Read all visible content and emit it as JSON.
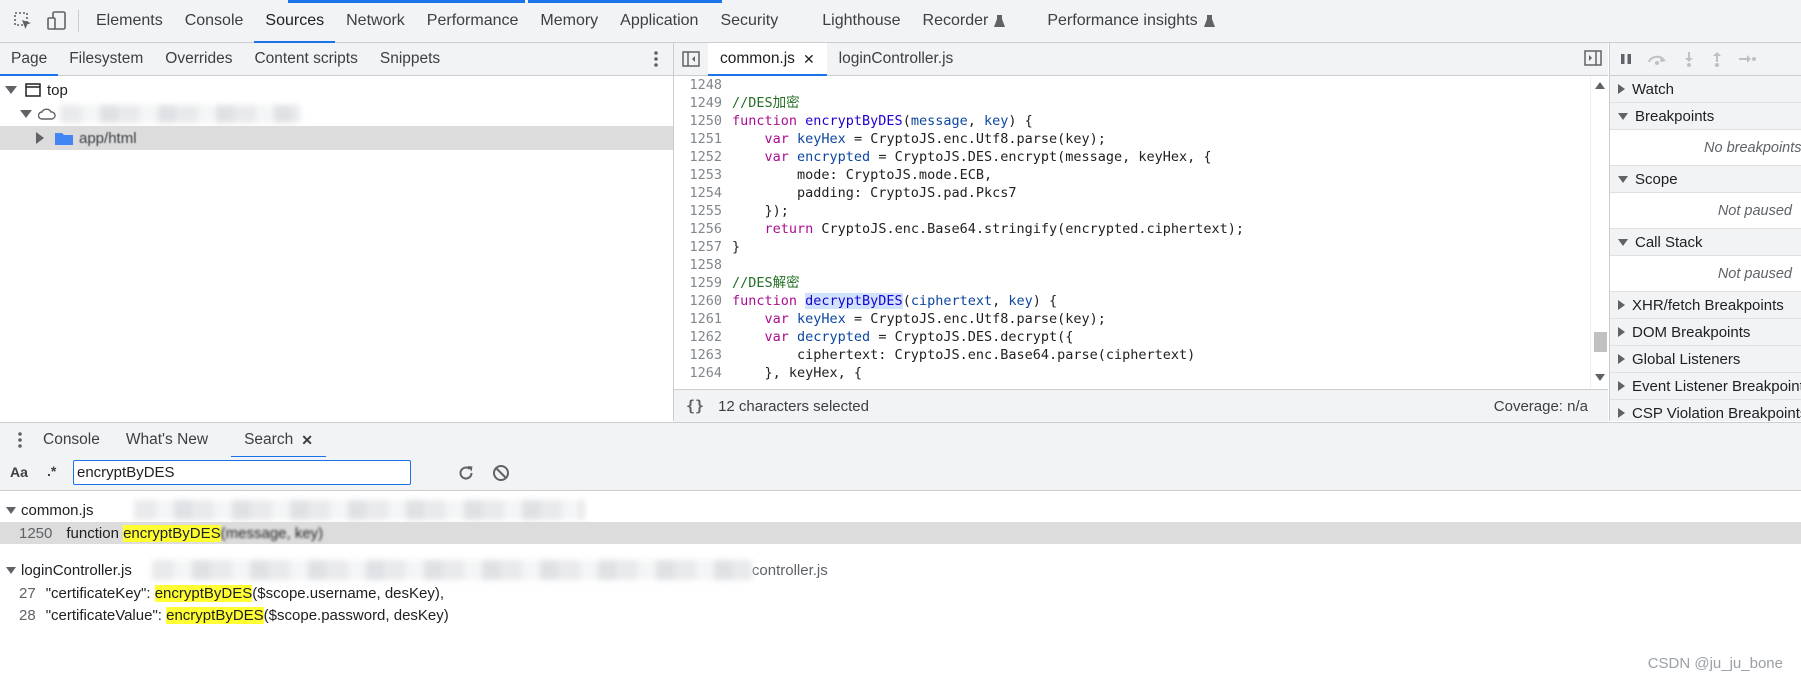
{
  "top_tabs": [
    "Elements",
    "Console",
    "Sources",
    "Network",
    "Performance",
    "Memory",
    "Application",
    "Security",
    "Lighthouse",
    "Recorder",
    "Performance insights"
  ],
  "top_tabs_active": "Sources",
  "nav_tabs": [
    "Page",
    "Filesystem",
    "Overrides",
    "Content scripts",
    "Snippets"
  ],
  "tree": {
    "top_label": "top",
    "folder_label": "app/html"
  },
  "editor_tabs": [
    "common.js",
    "loginController.js"
  ],
  "code_lines": [
    {
      "n": "1248",
      "parts": []
    },
    {
      "n": "1249",
      "parts": [
        {
          "c": "cm",
          "t": "//DES加密"
        }
      ]
    },
    {
      "n": "1250",
      "parts": [
        {
          "c": "kw",
          "t": "function "
        },
        {
          "c": "fn",
          "t": "encryptByDES"
        },
        {
          "c": "tx",
          "t": "("
        },
        {
          "c": "vr2",
          "t": "message"
        },
        {
          "c": "tx",
          "t": ", "
        },
        {
          "c": "vr2",
          "t": "key"
        },
        {
          "c": "tx",
          "t": ") {"
        }
      ]
    },
    {
      "n": "1251",
      "parts": [
        {
          "c": "tx",
          "t": "    "
        },
        {
          "c": "kw",
          "t": "var "
        },
        {
          "c": "vr2",
          "t": "keyHex"
        },
        {
          "c": "tx",
          "t": " = CryptoJS.enc.Utf8.parse(key);"
        }
      ]
    },
    {
      "n": "1252",
      "parts": [
        {
          "c": "tx",
          "t": "    "
        },
        {
          "c": "kw",
          "t": "var "
        },
        {
          "c": "vr2",
          "t": "encrypted"
        },
        {
          "c": "tx",
          "t": " = CryptoJS.DES.encrypt(message, keyHex, {"
        }
      ]
    },
    {
      "n": "1253",
      "parts": [
        {
          "c": "tx",
          "t": "        mode: CryptoJS.mode.ECB,"
        }
      ]
    },
    {
      "n": "1254",
      "parts": [
        {
          "c": "tx",
          "t": "        padding: CryptoJS.pad.Pkcs7"
        }
      ]
    },
    {
      "n": "1255",
      "parts": [
        {
          "c": "tx",
          "t": "    });"
        }
      ]
    },
    {
      "n": "1256",
      "parts": [
        {
          "c": "tx",
          "t": "    "
        },
        {
          "c": "kw",
          "t": "return "
        },
        {
          "c": "tx",
          "t": "CryptoJS.enc.Base64.stringify(encrypted.ciphertext);"
        }
      ]
    },
    {
      "n": "1257",
      "parts": [
        {
          "c": "tx",
          "t": "}"
        }
      ]
    },
    {
      "n": "1258",
      "parts": []
    },
    {
      "n": "1259",
      "parts": [
        {
          "c": "cm",
          "t": "//DES解密"
        }
      ]
    },
    {
      "n": "1260",
      "parts": [
        {
          "c": "kw",
          "t": "function "
        },
        {
          "c": "fn sel",
          "t": "decryptByDES"
        },
        {
          "c": "tx",
          "t": "("
        },
        {
          "c": "vr2",
          "t": "ciphertext"
        },
        {
          "c": "tx",
          "t": ", "
        },
        {
          "c": "vr2",
          "t": "key"
        },
        {
          "c": "tx",
          "t": ") {"
        }
      ]
    },
    {
      "n": "1261",
      "parts": [
        {
          "c": "tx",
          "t": "    "
        },
        {
          "c": "kw",
          "t": "var "
        },
        {
          "c": "vr2",
          "t": "keyHex"
        },
        {
          "c": "tx",
          "t": " = CryptoJS.enc.Utf8.parse(key);"
        }
      ]
    },
    {
      "n": "1262",
      "parts": [
        {
          "c": "tx",
          "t": "    "
        },
        {
          "c": "kw",
          "t": "var "
        },
        {
          "c": "vr2",
          "t": "decrypted"
        },
        {
          "c": "tx",
          "t": " = CryptoJS.DES.decrypt({"
        }
      ]
    },
    {
      "n": "1263",
      "parts": [
        {
          "c": "tx",
          "t": "        ciphertext: CryptoJS.enc.Base64.parse(ciphertext)"
        }
      ]
    },
    {
      "n": "1264",
      "parts": [
        {
          "c": "tx",
          "t": "    }, keyHex, {"
        }
      ]
    }
  ],
  "editor_status": {
    "selection": "12 characters selected",
    "coverage": "Coverage: n/a"
  },
  "debugger": {
    "watch": "Watch",
    "breakpoints": "Breakpoints",
    "no_breakpoints": "No breakpoints",
    "scope": "Scope",
    "not_paused": "Not paused",
    "call_stack": "Call Stack",
    "not_paused_2": "Not paused",
    "more": [
      "XHR/fetch Breakpoints",
      "DOM Breakpoints",
      "Global Listeners",
      "Event Listener Breakpoints",
      "CSP Violation Breakpoints"
    ]
  },
  "drawer_tabs": [
    "Console",
    "What's New",
    "Search"
  ],
  "search": {
    "case_label": "Aa",
    "regex_label": ".*",
    "query": "encryptByDES"
  },
  "results": {
    "file1": "common.js",
    "r1": {
      "line": "1250",
      "pre": "function ",
      "match": "encryptByDES",
      "post": "(message, key)"
    },
    "file2": "loginController.js",
    "file2_path_tail": "controller.js",
    "r2": {
      "line": "27",
      "pre": "\"certificateKey\": ",
      "match": "encryptByDES",
      "post": "($scope.username, desKey),"
    },
    "r3": {
      "line": "28",
      "pre": "\"certificateValue\": ",
      "match": "encryptByDES",
      "post": "($scope.password, desKey)"
    }
  },
  "watermark": "CSDN @ju_ju_bone",
  "colors": {
    "accent": "#1a73e8",
    "highlight": "#ffff33",
    "selection": "#cfe3fc"
  }
}
